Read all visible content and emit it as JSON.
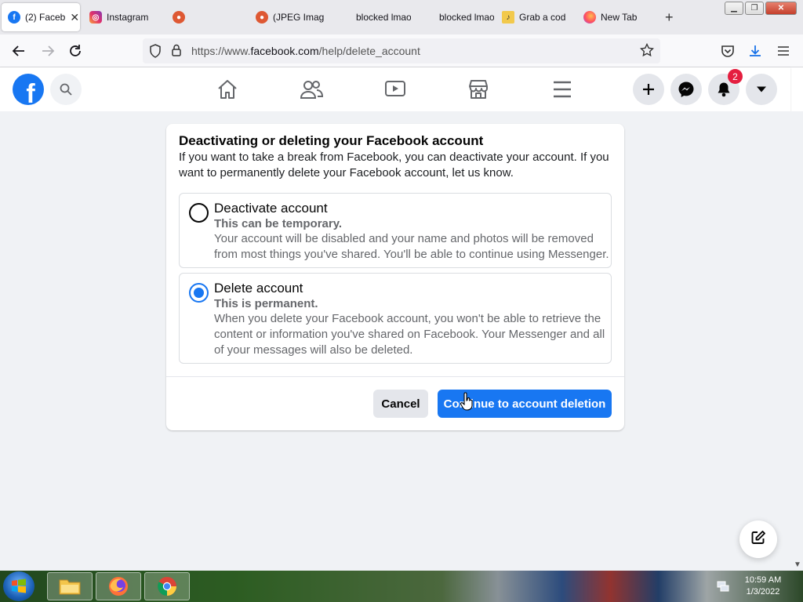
{
  "browser": {
    "tabs": [
      {
        "label": "(2) Faceb",
        "icon": "facebook-favicon",
        "active": true
      },
      {
        "label": "Instagram",
        "icon": "instagram-favicon"
      },
      {
        "label": "",
        "icon": "duckduckgo-favicon"
      },
      {
        "label": "(JPEG Imag",
        "icon": "duckduckgo-favicon"
      },
      {
        "label": "blocked lmao",
        "icon": "none"
      },
      {
        "label": "blocked lmao",
        "icon": "none"
      },
      {
        "label": "Grab a cod",
        "icon": "note-favicon"
      },
      {
        "label": "New Tab",
        "icon": "firefox-favicon"
      }
    ],
    "url_prefix": "https://www.",
    "url_domain": "facebook.com",
    "url_path": "/help/delete_account"
  },
  "facebook": {
    "logo": "f",
    "notification_count": "2"
  },
  "dialog": {
    "title": "Deactivating or deleting your Facebook account",
    "description": "If you want to take a break from Facebook, you can deactivate your account. If you want to permanently delete your Facebook account, let us know.",
    "options": [
      {
        "title": "Deactivate account",
        "subtitle": "This can be temporary.",
        "description": "Your account will be disabled and your name and photos will be removed from most things you've shared. You'll be able to continue using Messenger.",
        "selected": false
      },
      {
        "title": "Delete account",
        "subtitle": "This is permanent.",
        "description": "When you delete your Facebook account, you won't be able to retrieve the content or information you've shared on Facebook. Your Messenger and all of your messages will also be deleted.",
        "selected": true
      }
    ],
    "cancel_label": "Cancel",
    "continue_label": "Continue to account deletion"
  },
  "taskbar": {
    "time": "10:59 AM",
    "date": "1/3/2022"
  },
  "colors": {
    "facebook_blue": "#1877f2",
    "page_background": "#f0f2f5",
    "badge_red": "#e41e3f"
  }
}
